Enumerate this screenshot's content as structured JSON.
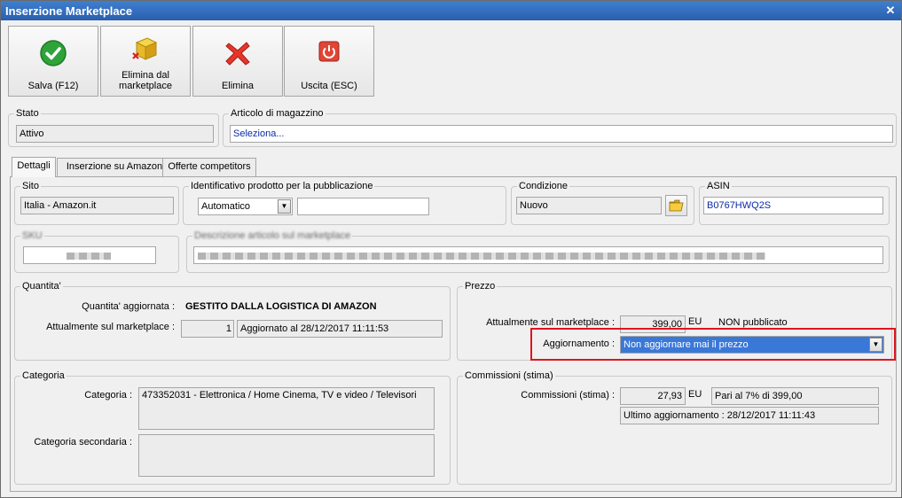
{
  "window": {
    "title": "Inserzione Marketplace",
    "close_glyph": "✕"
  },
  "toolbar": {
    "save_label": "Salva (F12)",
    "remove_marketplace_label": "Elimina dal\nmarketplace",
    "delete_label": "Elimina",
    "exit_label": "Uscita (ESC)"
  },
  "stato": {
    "legend": "Stato",
    "value": "Attivo"
  },
  "articolo": {
    "legend": "Articolo di magazzino",
    "value": "Seleziona..."
  },
  "tabs": [
    {
      "label": "Dettagli",
      "active": true
    },
    {
      "label": "Inserzione su Amazon",
      "active": false
    },
    {
      "label": "Offerte competitors",
      "active": false
    }
  ],
  "sito": {
    "legend": "Sito",
    "value": "Italia - Amazon.it"
  },
  "identificativo": {
    "legend": "Identificativo prodotto per la pubblicazione",
    "select_value": "Automatico",
    "input_value": ""
  },
  "condizione": {
    "legend": "Condizione",
    "value": "Nuovo",
    "icon": "folder-icon"
  },
  "asin": {
    "legend": "ASIN",
    "value": "B0767HWQ2S"
  },
  "sku": {
    "legend": "SKU"
  },
  "descrizione": {
    "legend": "Descrizione articolo sul marketplace"
  },
  "quantita": {
    "legend": "Quantita'",
    "aggiornata_label": "Quantita' aggiornata :",
    "aggiornata_value": "GESTITO DALLA LOGISTICA DI AMAZON",
    "attuale_label": "Attualmente sul marketplace :",
    "attuale_value": "1",
    "aggiornato_text": "Aggiornato al 28/12/2017 11:11:53"
  },
  "prezzo": {
    "legend": "Prezzo",
    "attuale_label": "Attualmente sul marketplace :",
    "attuale_value": "399,00",
    "currency": "EU",
    "status_text": "NON pubblicato",
    "aggiornamento_label": "Aggiornamento :",
    "aggiornamento_value": "Non aggiornare mai il prezzo"
  },
  "categoria": {
    "legend": "Categoria",
    "categoria_label": "Categoria :",
    "categoria_value": "473352031 - Elettronica / Home Cinema, TV e video / Televisori",
    "secondaria_label": "Categoria secondaria :",
    "secondaria_value": ""
  },
  "commissioni": {
    "legend": "Commissioni (stima)",
    "label": "Commissioni (stima) :",
    "value": "27,93",
    "currency": "EU",
    "pari_text": "Pari al 7% di 399,00",
    "ultimo_text": "Ultimo aggiornamento : 28/12/2017 11:11:43"
  },
  "colors": {
    "highlight": "#e0141f",
    "link_blue": "#0a2ba8",
    "selection": "#3a78d8"
  }
}
